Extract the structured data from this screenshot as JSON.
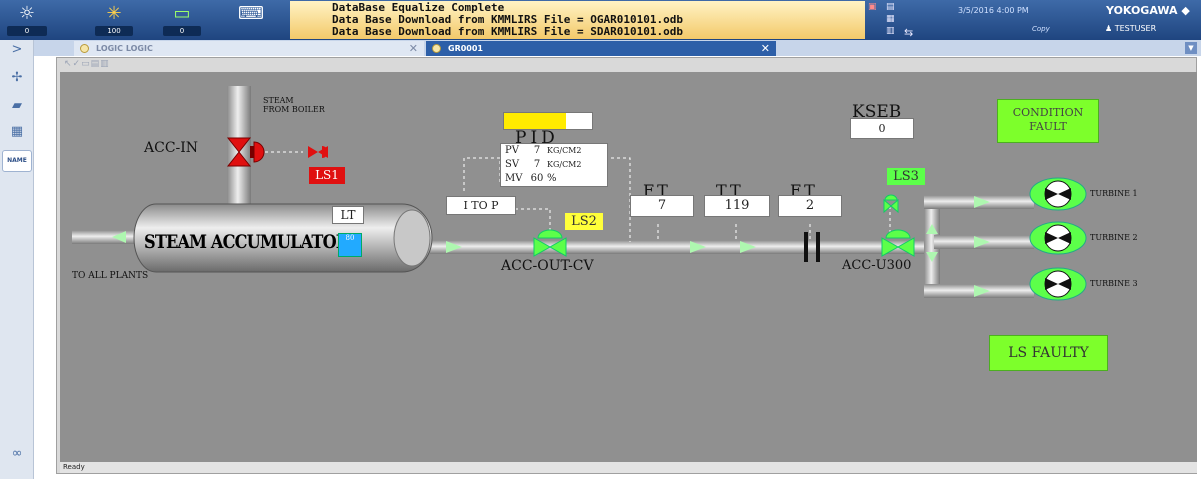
{
  "toolbar": {
    "counters": [
      {
        "icon": "alarm-sun-icon",
        "count": "0"
      },
      {
        "icon": "process-alarm-icon",
        "count": "100"
      },
      {
        "icon": "battery-icon",
        "count": "0"
      }
    ],
    "messages": [
      "DataBase Equalize Complete",
      "Data Base Download from KMMLIRS File = OGAR010101.odb",
      "Data Base Download from KMMLIRS File = SDAR010101.odb"
    ],
    "datetime": "3/5/2016 4:00 PM",
    "copy_label": "Copy",
    "brand": "YOKOGAWA ◆",
    "user": "TESTUSER"
  },
  "rail": {
    "name_button": "NAME"
  },
  "tabs": [
    {
      "label": "LOGIC LOGIC",
      "active": false
    },
    {
      "label": "GR0001",
      "active": true
    }
  ],
  "status_text": "Ready",
  "graphic": {
    "steam_from_boiler": [
      "STEAM",
      "FROM BOILER"
    ],
    "acc_in_label": "ACC-IN",
    "ls1": "LS1",
    "accumulator_label": "STEAM ACCUMULATOR",
    "lt_label": "LT",
    "lt_value": "80",
    "to_all_plants": "TO ALL PLANTS",
    "pid": {
      "title": "PID",
      "rows": [
        {
          "tag": "PV",
          "value": "7",
          "unit": "KG/CM2"
        },
        {
          "tag": "SV",
          "value": "7",
          "unit": "KG/CM2"
        },
        {
          "tag": "MV",
          "value": "60",
          "unit": "%"
        }
      ],
      "bar_fill": 0.7
    },
    "i_to_p": "I TO P",
    "ls2": "LS2",
    "acc_out_cv": "ACC-OUT-CV",
    "ft1": {
      "label": "FT",
      "value": "7"
    },
    "tt": {
      "label": "TT",
      "value": "119"
    },
    "ft2": {
      "label": "FT",
      "value": "2"
    },
    "kseb": {
      "label": "KSEB",
      "value": "0"
    },
    "ls3": "LS3",
    "acc_u300": "ACC-U300",
    "condition_fault": [
      "CONDITION",
      "FAULT"
    ],
    "ls_faulty": "LS FAULTY",
    "turbines": [
      "TURBINE 1",
      "TURBINE 2",
      "TURBINE 3"
    ]
  },
  "colors": {
    "pipe": "#b4b4b4",
    "flow_arrow": "#aef7b0",
    "valve_green": "#5cff4a",
    "valve_red": "#e01010",
    "alarm_yellow": "#ffff3a",
    "fault_green": "#7dff2b",
    "level_blue": "#22aaff"
  }
}
